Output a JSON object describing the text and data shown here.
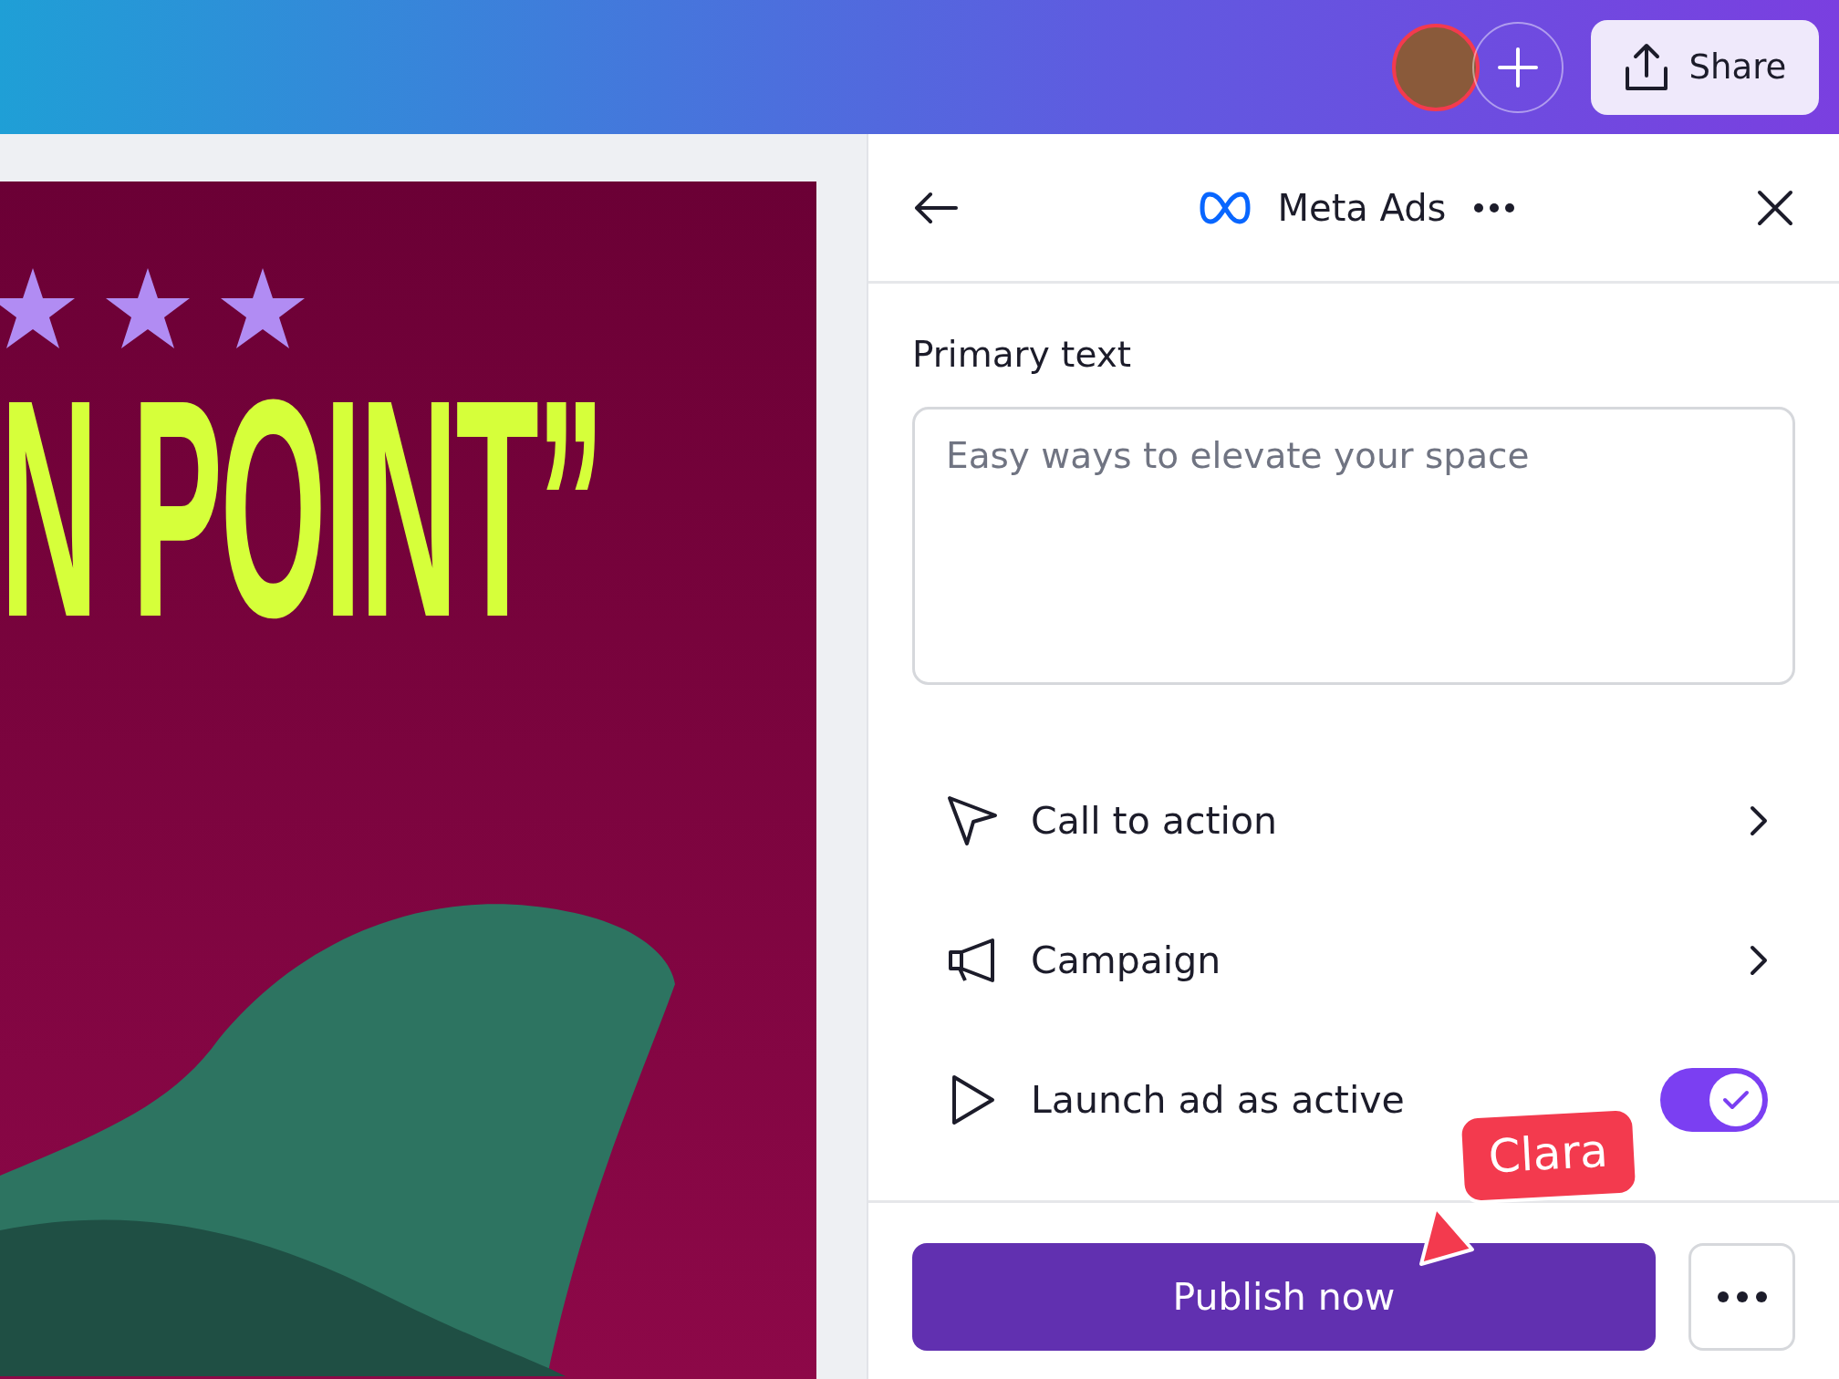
{
  "top_bar": {
    "share_button": "Share"
  },
  "design": {
    "headline": "N POINT”"
  },
  "panel": {
    "title": "Meta Ads",
    "primary_text": {
      "label": "Primary text",
      "placeholder": "Easy ways to elevate your space"
    },
    "options": [
      {
        "kind": "link",
        "label": "Call to action"
      },
      {
        "kind": "link",
        "label": "Campaign"
      },
      {
        "kind": "toggle",
        "label": "Launch ad as active",
        "on": true
      }
    ],
    "publish_button": "Publish now"
  },
  "cursor": {
    "name": "Clara",
    "color": "#f33a4e"
  }
}
